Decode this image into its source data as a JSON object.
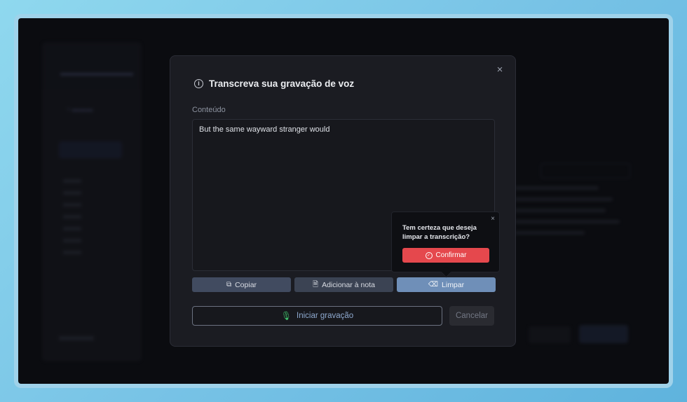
{
  "modal": {
    "title": "Transcreva sua gravação de voz",
    "close_icon": "×",
    "content_label": "Conteúdo",
    "content_value": "But the same wayward stranger would",
    "buttons": {
      "copy": "Copiar",
      "add_to_note": "Adicionar à nota",
      "clear": "Limpar"
    },
    "record_button": "Iniciar gravação",
    "cancel_button": "Cancelar"
  },
  "popover": {
    "question": "Tem certeza que deseja limpar a transcrição?",
    "confirm": "Confirmar",
    "close_icon": "×"
  },
  "icons": {
    "info": "info-icon",
    "copy": "copy-icon",
    "note": "note-add-icon",
    "clear": "broom-icon",
    "mic": "microphone-icon",
    "check": "check-circle-icon"
  },
  "colors": {
    "accent": "#6f8fb8",
    "danger": "#e5484d",
    "mic_green": "#3fbf6a"
  }
}
